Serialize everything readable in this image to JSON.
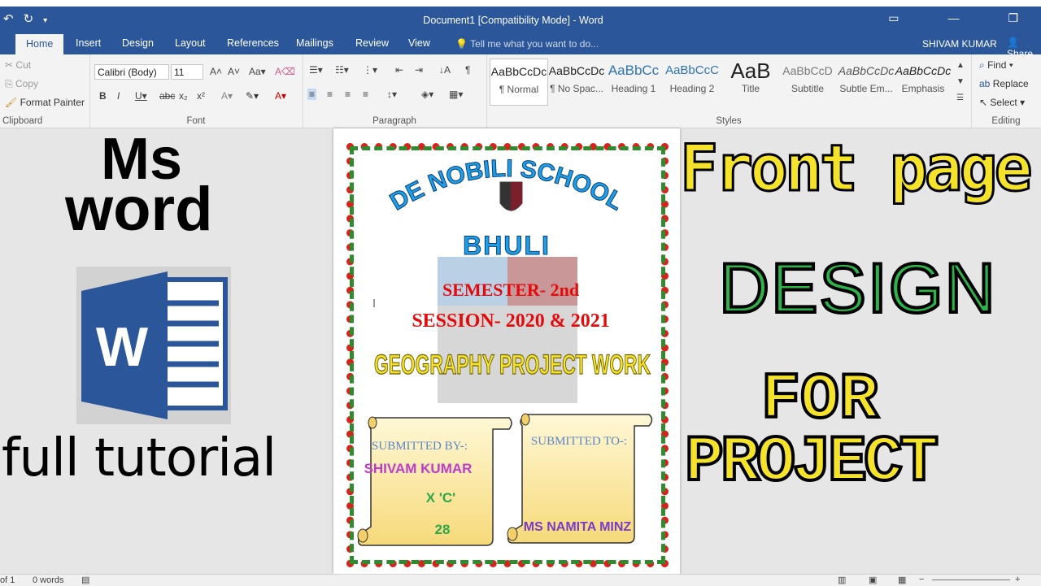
{
  "window": {
    "title": "Document1 [Compatibility Mode] - Word",
    "user": "SHIVAM KUMAR",
    "share": "Share"
  },
  "tabs": [
    "Home",
    "Insert",
    "Design",
    "Layout",
    "References",
    "Mailings",
    "Review",
    "View"
  ],
  "tell_me": "Tell me what you want to do...",
  "clipboard": {
    "cut": "Cut",
    "copy": "Copy",
    "format_painter": "Format Painter",
    "label": "Clipboard"
  },
  "font": {
    "name": "Calibri (Body)",
    "size": "11",
    "label": "Font"
  },
  "paragraph": {
    "label": "Paragraph"
  },
  "styles": {
    "label": "Styles",
    "items": [
      {
        "preview": "AaBbCcDc",
        "name": "¶ Normal"
      },
      {
        "preview": "AaBbCcDc",
        "name": "¶ No Spac..."
      },
      {
        "preview": "AaBbCc",
        "name": "Heading 1"
      },
      {
        "preview": "AaBbCcC",
        "name": "Heading 2"
      },
      {
        "preview": "AaB",
        "name": "Title"
      },
      {
        "preview": "AaBbCcD",
        "name": "Subtitle"
      },
      {
        "preview": "AaBbCcDc",
        "name": "Subtle Em..."
      },
      {
        "preview": "AaBbCcDc",
        "name": "Emphasis"
      }
    ]
  },
  "editing": {
    "find": "Find",
    "replace": "Replace",
    "select": "Select",
    "label": "Editing"
  },
  "page": {
    "school": "DE NOBILI SCHOOL",
    "place": "BHULI",
    "semester": "SEMESTER- 2nd",
    "session": "SESSION- 2020 & 2021",
    "project": "GEOGRAPHY PROJECT WORK",
    "submitted_by_label": "SUBMITTED BY-:",
    "student_name": "SHIVAM KUMAR",
    "student_class": "X 'C'",
    "student_roll": "28",
    "submitted_to_label": "SUBMITTED TO-:",
    "teacher_name": "MS NAMITA MINZ"
  },
  "overlay": {
    "ms": "Ms",
    "word": "word",
    "tutorial": "full tutorial",
    "front": "Front page",
    "design": "DESIGN",
    "for": "FOR",
    "project": "PROJECT"
  },
  "status": {
    "page": "of 1",
    "words": "0 words"
  },
  "colors": {
    "ribbon": "#2b579a",
    "border_red": "#d9221a",
    "border_green": "#2e8b2e",
    "yellow": "#f5e32b",
    "green": "#2db34a"
  }
}
